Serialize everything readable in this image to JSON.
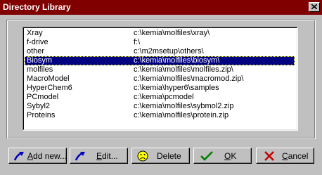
{
  "window": {
    "title": "Directory Library"
  },
  "directories": [
    {
      "name": "Xray",
      "path": "c:\\kemia\\molfiles\\xray\\"
    },
    {
      "name": "f-drive",
      "path": "f:\\"
    },
    {
      "name": "other",
      "path": "c:\\m2msetup\\others\\"
    },
    {
      "name": "Biosym",
      "path": "c:\\kemia\\molfiles\\biosym\\",
      "selected": true
    },
    {
      "name": "molfiles",
      "path": "c:\\kemia\\molfiles\\molfiles.zip\\"
    },
    {
      "name": "MacroModel",
      "path": "c:\\kemia\\molfiles\\macromod.zip\\"
    },
    {
      "name": "HyperChem6",
      "path": "c:\\kemia\\hyper6\\samples"
    },
    {
      "name": "PCmodel",
      "path": "c:\\kemia\\pcmodel"
    },
    {
      "name": "Sybyl2",
      "path": "c:\\kemia\\molfiles\\sybmol2.zip"
    },
    {
      "name": "Proteins",
      "path": "c:\\kemia\\molfiles\\protein.zip"
    }
  ],
  "buttons": {
    "add": {
      "mnemonic": "A",
      "rest": "dd new...",
      "icon": "blue-arrow-icon"
    },
    "edit": {
      "mnemonic": "E",
      "rest": "dit...",
      "icon": "blue-arrow-icon"
    },
    "delete": {
      "label": "Delete",
      "icon": "sad-face-icon"
    },
    "ok": {
      "mnemonic": "O",
      "rest": "K",
      "icon": "green-check-icon"
    },
    "cancel": {
      "mnemonic": "C",
      "rest": "ancel",
      "icon": "red-x-icon"
    }
  },
  "colors": {
    "title_bar": "#800000",
    "selection": "#000080",
    "dialog_bg": "#c0c0c0"
  }
}
